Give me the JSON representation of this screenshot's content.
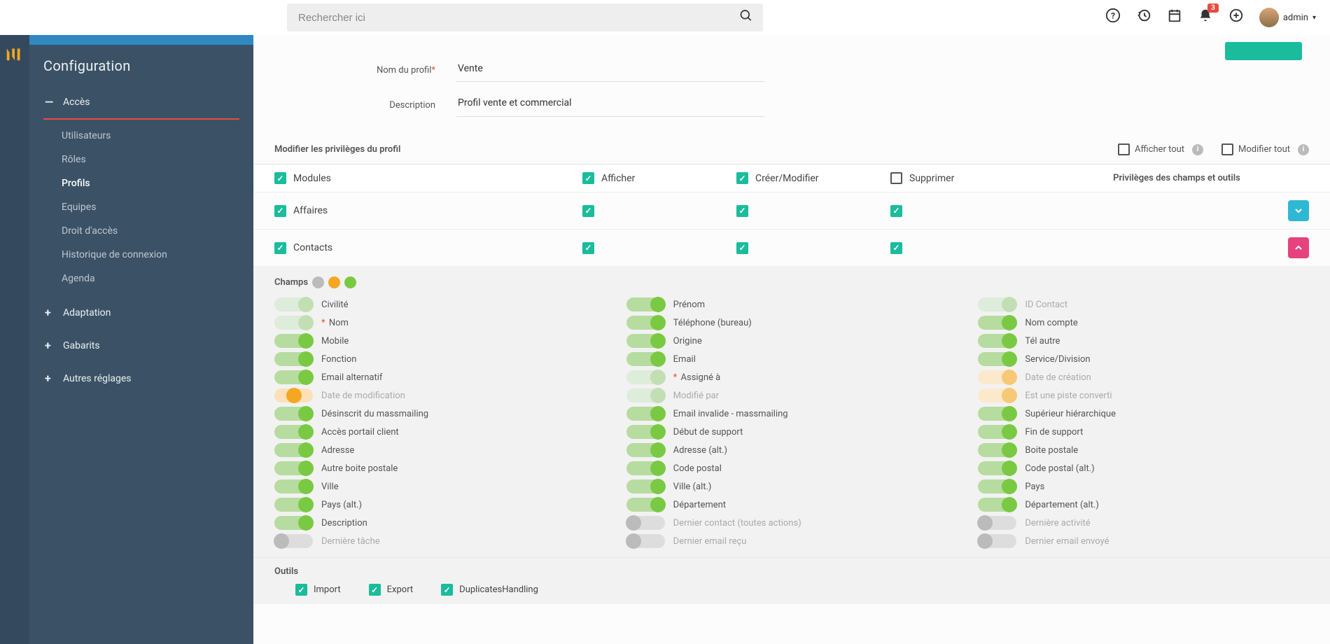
{
  "header": {
    "search_placeholder": "Rechercher ici",
    "notif_count": "3",
    "user_name": "admin"
  },
  "sidebar": {
    "title": "Configuration",
    "groups": [
      {
        "label": "Accès",
        "expanded": true,
        "items": [
          {
            "label": "Utilisateurs"
          },
          {
            "label": "Rôles"
          },
          {
            "label": "Profils",
            "active": true
          },
          {
            "label": "Equipes"
          },
          {
            "label": "Droit d'accès"
          },
          {
            "label": "Historique de connexion"
          },
          {
            "label": "Agenda"
          }
        ]
      },
      {
        "label": "Adaptation",
        "expanded": false
      },
      {
        "label": "Gabarits",
        "expanded": false
      },
      {
        "label": "Autres réglages",
        "expanded": false
      }
    ]
  },
  "form": {
    "name_label": "Nom du profil",
    "name_value": "Vente",
    "desc_label": "Description",
    "desc_value": "Profil vente et commercial"
  },
  "priv": {
    "section_title": "Modifier les privilèges du profil",
    "show_all": "Afficher tout",
    "edit_all": "Modifier tout",
    "cols": {
      "mod": "Modules",
      "aff": "Afficher",
      "cm": "Créer/Modifier",
      "sup": "Supprimer",
      "tools": "Privilèges des champs et outils"
    },
    "rows": [
      {
        "name": "Affaires",
        "aff": true,
        "cm": true,
        "sup": true,
        "expand": "teal"
      },
      {
        "name": "Contacts",
        "aff": true,
        "cm": true,
        "sup": true,
        "expand": "pink"
      }
    ]
  },
  "fields": {
    "label": "Champs",
    "col1": [
      {
        "t": "green-faded",
        "l": "Civilité",
        "m": false
      },
      {
        "t": "green-faded",
        "l": "Nom",
        "m": false,
        "req": true
      },
      {
        "t": "green-on",
        "l": "Mobile",
        "m": false
      },
      {
        "t": "green-on",
        "l": "Fonction",
        "m": false
      },
      {
        "t": "green-on",
        "l": "Email alternatif",
        "m": false
      },
      {
        "t": "orange",
        "l": "Date de modification",
        "m": true
      },
      {
        "t": "green-on",
        "l": "Désinscrit du massmailing",
        "m": false
      },
      {
        "t": "green-on",
        "l": "Accès portail client",
        "m": false
      },
      {
        "t": "green-on",
        "l": "Adresse",
        "m": false
      },
      {
        "t": "green-on",
        "l": "Autre boite postale",
        "m": false
      },
      {
        "t": "green-on",
        "l": "Ville",
        "m": false
      },
      {
        "t": "green-on",
        "l": "Pays (alt.)",
        "m": false
      },
      {
        "t": "green-on",
        "l": "Description",
        "m": false
      },
      {
        "t": "grey-off",
        "l": "Dernière tâche",
        "m": true
      }
    ],
    "col2": [
      {
        "t": "green-on",
        "l": "Prénom",
        "m": false
      },
      {
        "t": "green-on",
        "l": "Téléphone (bureau)",
        "m": false
      },
      {
        "t": "green-on",
        "l": "Origine",
        "m": false
      },
      {
        "t": "green-on",
        "l": "Email",
        "m": false
      },
      {
        "t": "green-faded",
        "l": "Assigné à",
        "m": false,
        "req": true
      },
      {
        "t": "green-faded",
        "l": "Modifié par",
        "m": true
      },
      {
        "t": "green-on",
        "l": "Email invalide - massmailing",
        "m": false
      },
      {
        "t": "green-on",
        "l": "Début de support",
        "m": false
      },
      {
        "t": "green-on",
        "l": "Adresse (alt.)",
        "m": false
      },
      {
        "t": "green-on",
        "l": "Code postal",
        "m": false
      },
      {
        "t": "green-on",
        "l": "Ville (alt.)",
        "m": false
      },
      {
        "t": "green-on",
        "l": "Département",
        "m": false
      },
      {
        "t": "grey-off",
        "l": "Dernier contact (toutes actions)",
        "m": true
      },
      {
        "t": "grey-off",
        "l": "Dernier email reçu",
        "m": true
      }
    ],
    "col3": [
      {
        "t": "green-faded",
        "l": "ID Contact",
        "m": true
      },
      {
        "t": "green-on",
        "l": "Nom compte",
        "m": false
      },
      {
        "t": "green-on",
        "l": "Tél autre",
        "m": false
      },
      {
        "t": "green-on",
        "l": "Service/Division",
        "m": false
      },
      {
        "t": "orange-light",
        "l": "Date de création",
        "m": true
      },
      {
        "t": "orange-light",
        "l": "Est une piste converti",
        "m": true
      },
      {
        "t": "green-on",
        "l": "Supérieur hiérarchique",
        "m": false
      },
      {
        "t": "green-on",
        "l": "Fin de support",
        "m": false
      },
      {
        "t": "green-on",
        "l": "Boite postale",
        "m": false
      },
      {
        "t": "green-on",
        "l": "Code postal (alt.)",
        "m": false
      },
      {
        "t": "green-on",
        "l": "Pays",
        "m": false
      },
      {
        "t": "green-on",
        "l": "Département (alt.)",
        "m": false
      },
      {
        "t": "grey-off",
        "l": "Dernière activité",
        "m": true
      },
      {
        "t": "grey-off",
        "l": "Dernier email envoyé",
        "m": true
      }
    ]
  },
  "tools": {
    "label": "Outils",
    "items": [
      {
        "label": "Import",
        "on": true
      },
      {
        "label": "Export",
        "on": true
      },
      {
        "label": "DuplicatesHandling",
        "on": true
      }
    ]
  }
}
